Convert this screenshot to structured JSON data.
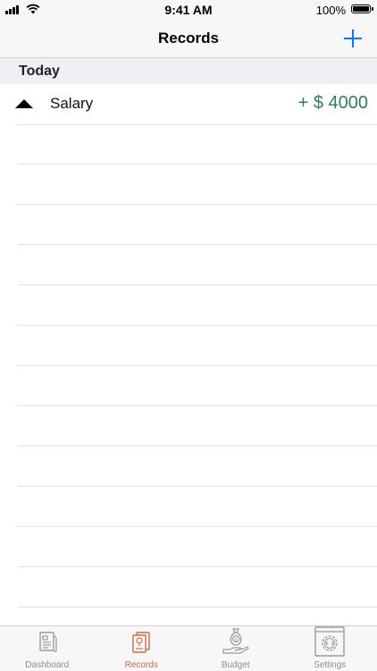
{
  "status_bar": {
    "time": "9:41 AM",
    "battery": "100%"
  },
  "nav": {
    "title": "Records",
    "add_icon": "plus-icon"
  },
  "section": {
    "title": "Today"
  },
  "records": [
    {
      "name": "Salary",
      "amount": "+ $ 4000",
      "type": "income",
      "icon": "triangle-up-icon"
    }
  ],
  "tabs": [
    {
      "label": "Dashboard",
      "icon": "dashboard-icon",
      "active": false
    },
    {
      "label": "Records",
      "icon": "records-icon",
      "active": true
    },
    {
      "label": "Budget",
      "icon": "budget-icon",
      "active": false
    },
    {
      "label": "Settings",
      "icon": "settings-icon",
      "active": false
    }
  ],
  "colors": {
    "accent": "#007aff",
    "income": "#2e7d5b",
    "active_tab": "#d4663b",
    "inactive_tab": "#8e8e93"
  }
}
